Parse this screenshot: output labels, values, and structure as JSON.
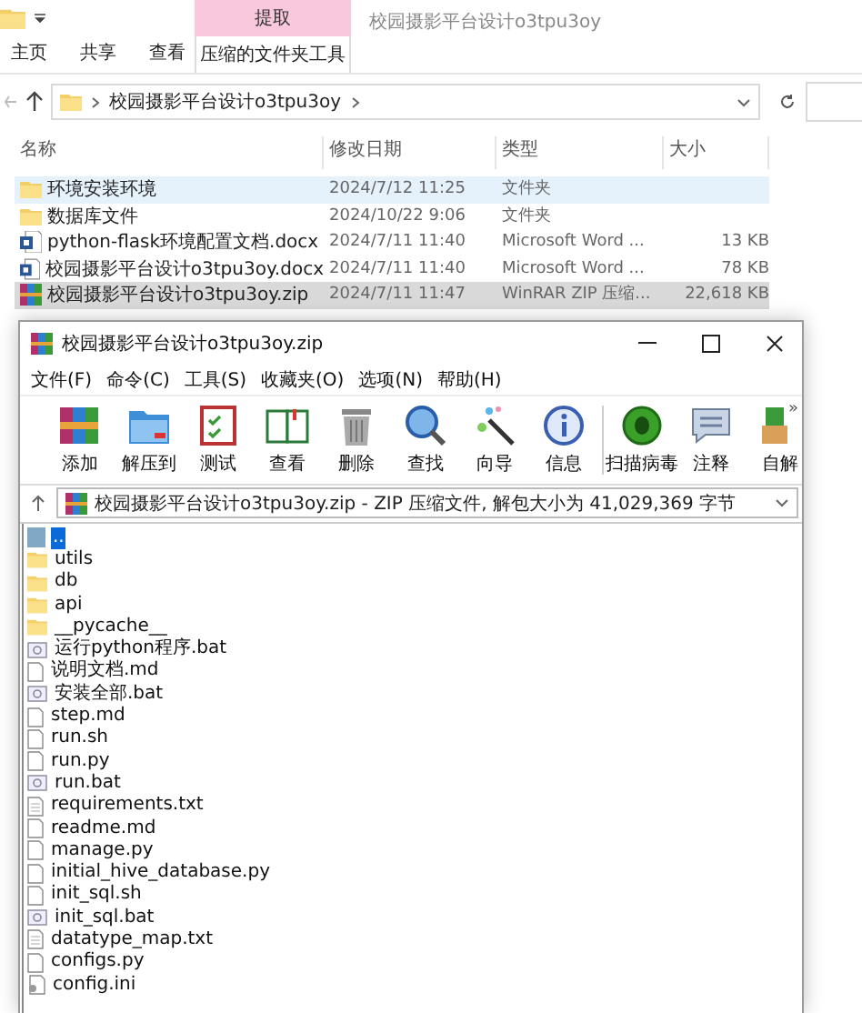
{
  "explorer": {
    "ribbon_tabs": [
      {
        "label": "主页",
        "selected": false
      },
      {
        "label": "共享",
        "selected": false
      },
      {
        "label": "查看",
        "selected": false
      }
    ],
    "context_tab": {
      "group": "提取",
      "label": "压缩的文件夹工具",
      "selected": true
    },
    "title": "校园摄影平台设计o3tpu3oy",
    "address": "校园摄影平台设计o3tpu3oy",
    "columns": [
      "名称",
      "修改日期",
      "类型",
      "大小"
    ],
    "files": [
      {
        "kind": "folder",
        "name": "环境安装环境",
        "date": "2024/7/12 11:25",
        "type": "文件夹",
        "hovered": true,
        "selected": false
      },
      {
        "kind": "folder",
        "name": "数据库文件",
        "date": "2024/10/22 9:06",
        "type": "文件夹",
        "hovered": false,
        "selected": false
      },
      {
        "kind": "word",
        "name": "python-flask环境配置文档.docx",
        "date": "2024/7/11 11:40",
        "type": "Microsoft Word ...",
        "size": "13 KB",
        "hovered": false,
        "selected": false
      },
      {
        "kind": "word",
        "name": "校园摄影平台设计o3tpu3oy.docx",
        "date": "2024/7/11 11:40",
        "type": "Microsoft Word ...",
        "size": "78 KB",
        "hovered": false,
        "selected": false
      },
      {
        "kind": "zip",
        "name": "校园摄影平台设计o3tpu3oy.zip",
        "date": "2024/7/11 11:47",
        "type": "WinRAR ZIP 压缩...",
        "size": "22,618 KB",
        "hovered": false,
        "selected": true
      }
    ]
  },
  "winrar": {
    "title": "校园摄影平台设计o3tpu3oy.zip",
    "menu": [
      "文件(F)",
      "命令(C)",
      "工具(S)",
      "收藏夹(O)",
      "选项(N)",
      "帮助(H)"
    ],
    "toolbar": [
      {
        "kind": "add",
        "label": "添加"
      },
      {
        "kind": "extract",
        "label": "解压到"
      },
      {
        "kind": "test",
        "label": "测试"
      },
      {
        "kind": "view",
        "label": "查看"
      },
      {
        "kind": "delete",
        "label": "删除"
      },
      {
        "kind": "find",
        "label": "查找"
      },
      {
        "kind": "wizard",
        "label": "向导"
      },
      {
        "kind": "info",
        "label": "信息"
      },
      {
        "kind": "scan",
        "label": "扫描病毒"
      },
      {
        "kind": "comment",
        "label": "注释"
      },
      {
        "kind": "sfx",
        "label": "自解"
      }
    ],
    "more": "»",
    "address": "校园摄影平台设计o3tpu3oy.zip - ZIP 压缩文件, 解包大小为 41,029,369 字节",
    "files": [
      {
        "kind": "up",
        "name": "..",
        "selected": true
      },
      {
        "kind": "folder",
        "name": "utils",
        "selected": false
      },
      {
        "kind": "folder",
        "name": "db",
        "selected": false
      },
      {
        "kind": "folder",
        "name": "api",
        "selected": false
      },
      {
        "kind": "folder",
        "name": "__pycache__",
        "selected": false
      },
      {
        "kind": "bat",
        "name": "运行python程序.bat",
        "selected": false
      },
      {
        "kind": "file",
        "name": "说明文档.md",
        "selected": false
      },
      {
        "kind": "bat",
        "name": "安装全部.bat",
        "selected": false
      },
      {
        "kind": "file",
        "name": "step.md",
        "selected": false
      },
      {
        "kind": "file",
        "name": "run.sh",
        "selected": false
      },
      {
        "kind": "file",
        "name": "run.py",
        "selected": false
      },
      {
        "kind": "bat",
        "name": "run.bat",
        "selected": false
      },
      {
        "kind": "text",
        "name": "requirements.txt",
        "selected": false
      },
      {
        "kind": "file",
        "name": "readme.md",
        "selected": false
      },
      {
        "kind": "file",
        "name": "manage.py",
        "selected": false
      },
      {
        "kind": "file",
        "name": "initial_hive_database.py",
        "selected": false
      },
      {
        "kind": "file",
        "name": "init_sql.sh",
        "selected": false
      },
      {
        "kind": "bat",
        "name": "init_sql.bat",
        "selected": false
      },
      {
        "kind": "text",
        "name": "datatype_map.txt",
        "selected": false
      },
      {
        "kind": "file",
        "name": "configs.py",
        "selected": false
      },
      {
        "kind": "ini",
        "name": "config.ini",
        "selected": false
      }
    ]
  }
}
